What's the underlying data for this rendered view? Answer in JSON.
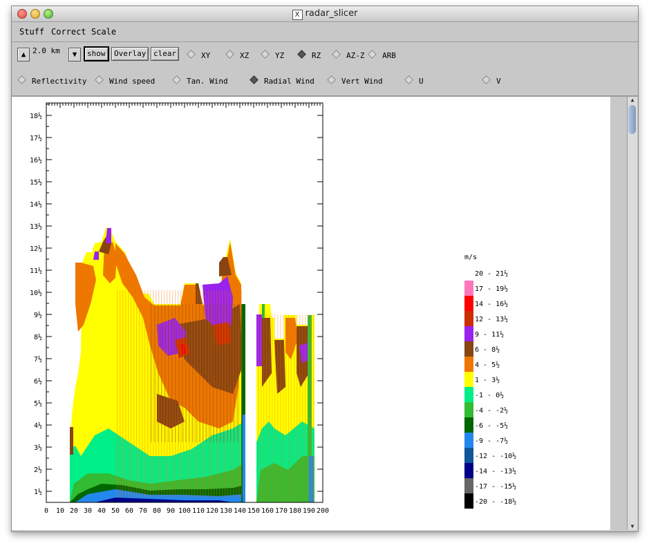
{
  "window": {
    "title": "radar_slicer"
  },
  "menu": [
    "Stuff",
    "Correct",
    "Scale"
  ],
  "toolbar": {
    "height_value": "2.0 km",
    "show_label": "show",
    "overlay_label": "Overlay",
    "clear_label": "clear",
    "planes": [
      {
        "label": "XY",
        "selected": false
      },
      {
        "label": "XZ",
        "selected": false
      },
      {
        "label": "YZ",
        "selected": false
      },
      {
        "label": "RZ",
        "selected": true
      },
      {
        "label": "AZ-Z",
        "selected": false
      },
      {
        "label": "ARB",
        "selected": false
      }
    ],
    "fields": [
      {
        "label": "Reflectivity",
        "selected": false
      },
      {
        "label": "Wind speed",
        "selected": false
      },
      {
        "label": "Tan. Wind",
        "selected": false
      },
      {
        "label": "Radial Wind",
        "selected": true
      },
      {
        "label": "Vert Wind",
        "selected": false
      },
      {
        "label": "U",
        "selected": false
      },
      {
        "label": "V",
        "selected": false
      }
    ]
  },
  "plot": {
    "y_ticks": [
      "1½",
      "2½",
      "3½",
      "4½",
      "5½",
      "6½",
      "7½",
      "8½",
      "9½",
      "10½",
      "11½",
      "12½",
      "13½",
      "14½",
      "15½",
      "16½",
      "17½",
      "18½"
    ],
    "x_ticks": [
      "0",
      "10",
      "20",
      "30",
      "40",
      "50",
      "60",
      "70",
      "80",
      "90",
      "100",
      "110",
      "120",
      "130",
      "140",
      "150",
      "160",
      "170",
      "180",
      "190",
      "200"
    ]
  },
  "legend": {
    "unit": "m/s",
    "entries": [
      {
        "label": "20 - 21½",
        "color": "#ffffff"
      },
      {
        "label": "17 - 19½",
        "color": "#ff77bb"
      },
      {
        "label": "14 - 16½",
        "color": "#ff0000"
      },
      {
        "label": "12 - 13½",
        "color": "#cc2e00"
      },
      {
        "label": "9 - 11½",
        "color": "#9922ee"
      },
      {
        "label": "6 - 8½",
        "color": "#884411"
      },
      {
        "label": "4 - 5½",
        "color": "#ee7700"
      },
      {
        "label": "1 - 3½",
        "color": "#ffff00"
      },
      {
        "label": "-1 - 0½",
        "color": "#00ee88"
      },
      {
        "label": "-4 - -2½",
        "color": "#33bb33"
      },
      {
        "label": "-6 - -5½",
        "color": "#006600"
      },
      {
        "label": "-9 - -7½",
        "color": "#2288ee"
      },
      {
        "label": "-12 - -10½",
        "color": "#115599"
      },
      {
        "label": "-14 - -13½",
        "color": "#000088"
      },
      {
        "label": "-17 - -15½",
        "color": "#666666"
      },
      {
        "label": "-20 - -18½",
        "color": "#000000"
      }
    ]
  }
}
